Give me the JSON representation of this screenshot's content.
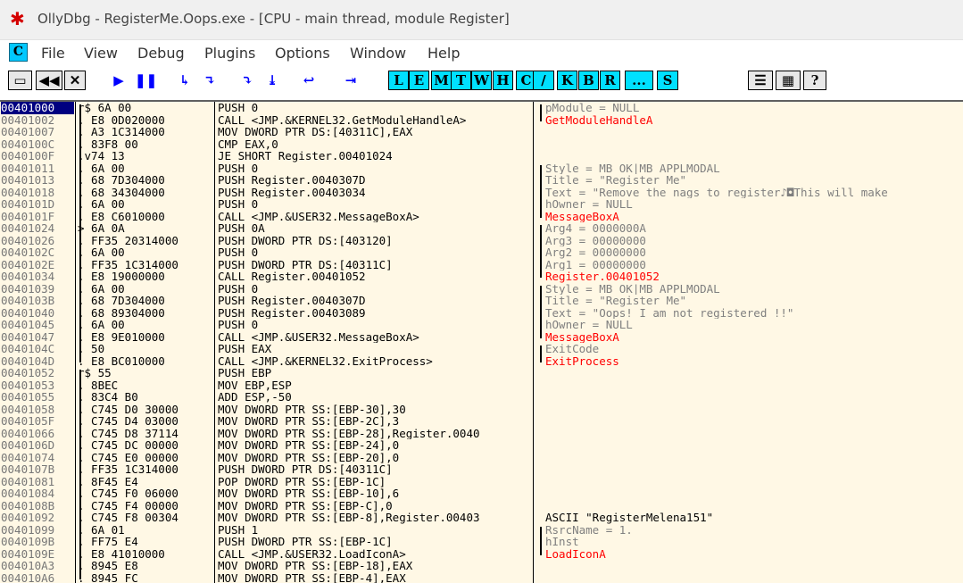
{
  "window": {
    "title": "OllyDbg - RegisterMe.Oops.exe - [CPU - main thread, module Register]"
  },
  "menu": [
    "File",
    "View",
    "Debug",
    "Plugins",
    "Options",
    "Window",
    "Help"
  ],
  "toolbar": {
    "buttons": [
      {
        "name": "open-icon",
        "glyph": "▭"
      },
      {
        "name": "restart-icon",
        "glyph": "◀◀"
      },
      {
        "name": "close-icon",
        "glyph": "✕"
      },
      {
        "name": "run-icon",
        "glyph": "▶"
      },
      {
        "name": "pause-icon",
        "glyph": "❚❚"
      },
      {
        "name": "step-into-icon",
        "glyph": "↳"
      },
      {
        "name": "step-over-icon",
        "glyph": "↴"
      },
      {
        "name": "trace-into-icon",
        "glyph": "⤵"
      },
      {
        "name": "trace-over-icon",
        "glyph": "⤓"
      },
      {
        "name": "execute-till-return-icon",
        "glyph": "↩"
      },
      {
        "name": "goto-icon",
        "glyph": "⇥"
      }
    ],
    "windows": [
      "L",
      "E",
      "M",
      "T",
      "W",
      "H",
      "C",
      "/",
      "K",
      "B",
      "R",
      "...",
      "S"
    ],
    "extra": [
      {
        "name": "list-icon",
        "glyph": "☰"
      },
      {
        "name": "palette-icon",
        "glyph": "▦"
      },
      {
        "name": "help-icon",
        "glyph": "?"
      }
    ]
  },
  "rows": [
    {
      "a": "00401000",
      "m": "r$",
      "h": "6A 00",
      "d": "PUSH 0",
      "c": "pModule = NULL",
      "cc": "gray"
    },
    {
      "a": "00401002",
      "m": ".",
      "h": "E8 0D020000",
      "d": "CALL <JMP.&KERNEL32.GetModuleHandleA>",
      "c": "GetModuleHandleA",
      "cc": "red"
    },
    {
      "a": "00401007",
      "m": ".",
      "h": "A3 1C314000",
      "d": "MOV DWORD PTR DS:[40311C],EAX",
      "c": "",
      "cc": ""
    },
    {
      "a": "0040100C",
      "m": ".",
      "h": "83F8 00",
      "d": "CMP EAX,0",
      "c": "",
      "cc": ""
    },
    {
      "a": "0040100F",
      "m": ".v74 13",
      "h": "",
      "d": "JE SHORT Register.00401024",
      "c": "",
      "cc": ""
    },
    {
      "a": "00401011",
      "m": ".",
      "h": "6A 00",
      "d": "PUSH 0",
      "c": "Style = MB_OK|MB_APPLMODAL",
      "cc": "gray"
    },
    {
      "a": "00401013",
      "m": ".",
      "h": "68 7D304000",
      "d": "PUSH Register.0040307D",
      "c": "Title = \"Register Me\"",
      "cc": "gray"
    },
    {
      "a": "00401018",
      "m": ".",
      "h": "68 34304000",
      "d": "PUSH Register.00403034",
      "c": "Text = \"Remove the nags to register♪◘This will make",
      "cc": "gray"
    },
    {
      "a": "0040101D",
      "m": ".",
      "h": "6A 00",
      "d": "PUSH 0",
      "c": "hOwner = NULL",
      "cc": "gray"
    },
    {
      "a": "0040101F",
      "m": ".",
      "h": "E8 C6010000",
      "d": "CALL <JMP.&USER32.MessageBoxA>",
      "c": "MessageBoxA",
      "cc": "red"
    },
    {
      "a": "00401024",
      "m": ">",
      "h": "6A 0A",
      "d": "PUSH 0A",
      "c": "Arg4 = 0000000A",
      "cc": "gray"
    },
    {
      "a": "00401026",
      "m": ".",
      "h": "FF35 20314000",
      "d": "PUSH DWORD PTR DS:[403120]",
      "c": "Arg3 = 00000000",
      "cc": "gray"
    },
    {
      "a": "0040102C",
      "m": ".",
      "h": "6A 00",
      "d": "PUSH 0",
      "c": "Arg2 = 00000000",
      "cc": "gray"
    },
    {
      "a": "0040102E",
      "m": ".",
      "h": "FF35 1C314000",
      "d": "PUSH DWORD PTR DS:[40311C]",
      "c": "Arg1 = 00000000",
      "cc": "gray"
    },
    {
      "a": "00401034",
      "m": ".",
      "h": "E8 19000000",
      "d": "CALL Register.00401052",
      "c": "Register.00401052",
      "cc": "red"
    },
    {
      "a": "00401039",
      "m": ".",
      "h": "6A 00",
      "d": "PUSH 0",
      "c": "Style = MB_OK|MB_APPLMODAL",
      "cc": "gray"
    },
    {
      "a": "0040103B",
      "m": ".",
      "h": "68 7D304000",
      "d": "PUSH Register.0040307D",
      "c": "Title = \"Register Me\"",
      "cc": "gray"
    },
    {
      "a": "00401040",
      "m": ".",
      "h": "68 89304000",
      "d": "PUSH Register.00403089",
      "c": "Text = \"Oops! I am not registered !!\"",
      "cc": "gray"
    },
    {
      "a": "00401045",
      "m": ".",
      "h": "6A 00",
      "d": "PUSH 0",
      "c": "hOwner = NULL",
      "cc": "gray"
    },
    {
      "a": "00401047",
      "m": ".",
      "h": "E8 9E010000",
      "d": "CALL <JMP.&USER32.MessageBoxA>",
      "c": "MessageBoxA",
      "cc": "red"
    },
    {
      "a": "0040104C",
      "m": ".",
      "h": "50",
      "d": "PUSH EAX",
      "c": "ExitCode",
      "cc": "gray"
    },
    {
      "a": "0040104D",
      "m": ".",
      "h": "E8 BC010000",
      "d": "CALL <JMP.&KERNEL32.ExitProcess>",
      "c": "ExitProcess",
      "cc": "red"
    },
    {
      "a": "00401052",
      "m": "r$",
      "h": "55",
      "d": "PUSH EBP",
      "c": "",
      "cc": ""
    },
    {
      "a": "00401053",
      "m": ".",
      "h": "8BEC",
      "d": "MOV EBP,ESP",
      "c": "",
      "cc": ""
    },
    {
      "a": "00401055",
      "m": ".",
      "h": "83C4 B0",
      "d": "ADD ESP,-50",
      "c": "",
      "cc": ""
    },
    {
      "a": "00401058",
      "m": ".",
      "h": "C745 D0 30000",
      "d": "MOV DWORD PTR SS:[EBP-30],30",
      "c": "",
      "cc": ""
    },
    {
      "a": "0040105F",
      "m": ".",
      "h": "C745 D4 03000",
      "d": "MOV DWORD PTR SS:[EBP-2C],3",
      "c": "",
      "cc": ""
    },
    {
      "a": "00401066",
      "m": ".",
      "h": "C745 D8 37114",
      "d": "MOV DWORD PTR SS:[EBP-28],Register.0040",
      "c": "",
      "cc": ""
    },
    {
      "a": "0040106D",
      "m": ".",
      "h": "C745 DC 00000",
      "d": "MOV DWORD PTR SS:[EBP-24],0",
      "c": "",
      "cc": ""
    },
    {
      "a": "00401074",
      "m": ".",
      "h": "C745 E0 00000",
      "d": "MOV DWORD PTR SS:[EBP-20],0",
      "c": "",
      "cc": ""
    },
    {
      "a": "0040107B",
      "m": ".",
      "h": "FF35 1C314000",
      "d": "PUSH DWORD PTR DS:[40311C]",
      "c": "",
      "cc": ""
    },
    {
      "a": "00401081",
      "m": ".",
      "h": "8F45 E4",
      "d": "POP DWORD PTR SS:[EBP-1C]",
      "c": "",
      "cc": ""
    },
    {
      "a": "00401084",
      "m": ".",
      "h": "C745 F0 06000",
      "d": "MOV DWORD PTR SS:[EBP-10],6",
      "c": "",
      "cc": ""
    },
    {
      "a": "0040108B",
      "m": ".",
      "h": "C745 F4 00000",
      "d": "MOV DWORD PTR SS:[EBP-C],0",
      "c": "",
      "cc": ""
    },
    {
      "a": "00401092",
      "m": ".",
      "h": "C745 F8 00304",
      "d": "MOV DWORD PTR SS:[EBP-8],Register.00403",
      "c": "ASCII \"RegisterMelena151\"",
      "cc": ""
    },
    {
      "a": "00401099",
      "m": ".",
      "h": "6A 01",
      "d": "PUSH 1",
      "c": "RsrcName = 1.",
      "cc": "gray"
    },
    {
      "a": "0040109B",
      "m": ".",
      "h": "FF75 E4",
      "d": "PUSH DWORD PTR SS:[EBP-1C]",
      "c": "hInst",
      "cc": "gray"
    },
    {
      "a": "0040109E",
      "m": ".",
      "h": "E8 41010000",
      "d": "CALL <JMP.&USER32.LoadIconA>",
      "c": "LoadIconA",
      "cc": "red"
    },
    {
      "a": "004010A3",
      "m": ".",
      "h": "8945 E8",
      "d": "MOV DWORD PTR SS:[EBP-18],EAX",
      "c": "",
      "cc": ""
    },
    {
      "a": "004010A6",
      "m": ".",
      "h": "8945 FC",
      "d": "MOV DWORD PTR SS:[EBP-4],EAX",
      "c": "",
      "cc": ""
    }
  ]
}
